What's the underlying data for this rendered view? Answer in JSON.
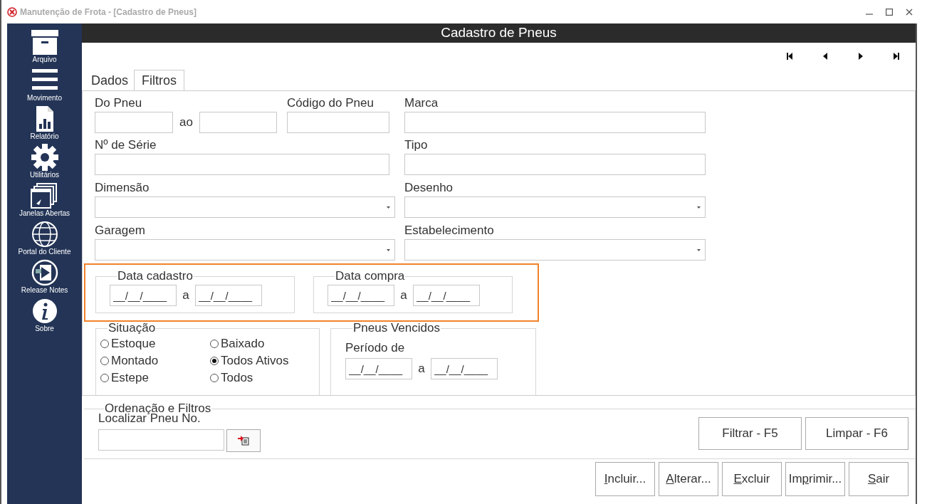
{
  "window": {
    "title": "Manutenção de Frota - [Cadastro de Pneus]"
  },
  "sidebar": {
    "items": [
      {
        "label": "Arquivo"
      },
      {
        "label": "Movimento"
      },
      {
        "label": "Relatório"
      },
      {
        "label": "Utilitários"
      },
      {
        "label": "Janelas Abertas"
      },
      {
        "label": "Portal do Cliente"
      },
      {
        "label": "Release Notes"
      },
      {
        "label": "Sobre"
      }
    ]
  },
  "header": {
    "title": "Cadastro de Pneus"
  },
  "tabs": [
    {
      "label": "Dados",
      "selected": false
    },
    {
      "label": "Filtros",
      "selected": true
    }
  ],
  "filters": {
    "do_pneu": {
      "label": "Do Pneu",
      "between": "ao"
    },
    "codigo": {
      "label": "Código do Pneu"
    },
    "marca": {
      "label": "Marca"
    },
    "serie": {
      "label": "Nº de Série"
    },
    "tipo": {
      "label": "Tipo"
    },
    "dimensao": {
      "label": "Dimensão"
    },
    "desenho": {
      "label": "Desenho"
    },
    "garagem": {
      "label": "Garagem"
    },
    "estabelecimento": {
      "label": "Estabelecimento"
    },
    "date_groups": [
      {
        "legend": "Data cadastro",
        "from": "__/__/____",
        "between": "a",
        "to": "__/__/____"
      },
      {
        "legend": "Data compra",
        "from": "__/__/____",
        "between": "a",
        "to": "__/__/____"
      }
    ],
    "situacao": {
      "legend": "Situação",
      "options": [
        {
          "label": "Estoque",
          "selected": false
        },
        {
          "label": "Baixado",
          "selected": false
        },
        {
          "label": "Montado",
          "selected": false
        },
        {
          "label": "Todos Ativos",
          "selected": true
        },
        {
          "label": "Estepe",
          "selected": false
        },
        {
          "label": "Todos",
          "selected": false
        }
      ]
    },
    "vencidos": {
      "legend": "Pneus Vencidos",
      "label": "Período de",
      "from": "__/__/____",
      "between": "a",
      "to": "__/__/____"
    }
  },
  "ordenacao": {
    "legend": "Ordenação e Filtros",
    "search_label": "Localizar Pneu No.",
    "buttons": [
      "Filtrar - F5",
      "Limpar - F6"
    ]
  },
  "actions": [
    {
      "key": "I",
      "rest": "ncluir..."
    },
    {
      "key": "A",
      "rest": "lterar..."
    },
    {
      "key": "E",
      "rest": "xcluir"
    },
    {
      "lead": "Im",
      "key": "p",
      "rest": "rimir..."
    },
    {
      "key": "S",
      "rest": "air"
    }
  ]
}
